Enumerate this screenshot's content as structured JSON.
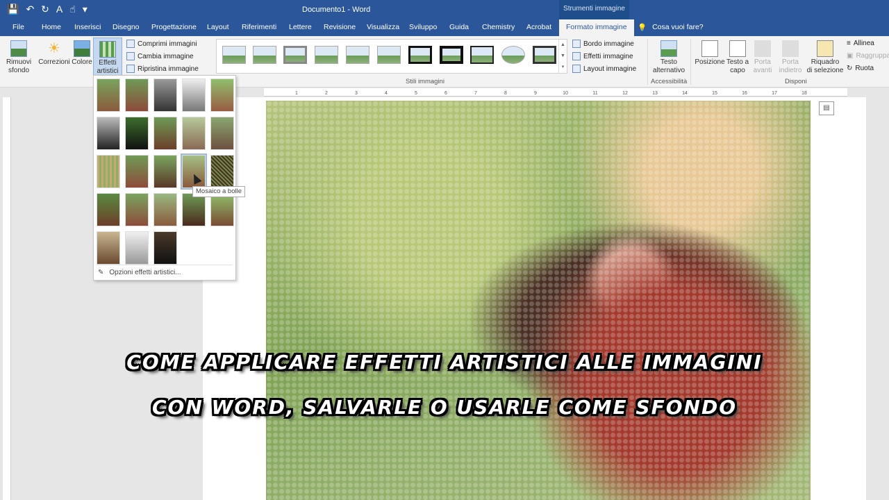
{
  "titlebar": {
    "title": "Documento1  -  Word",
    "context_group": "Strumenti immagine",
    "qat_icons": [
      "save-icon",
      "undo-icon",
      "redo-icon",
      "font-size-icon",
      "touch-mode-icon",
      "customize-qat-icon"
    ]
  },
  "tabs": {
    "file": "File",
    "home": "Home",
    "insert": "Inserisci",
    "draw": "Disegno",
    "design": "Progettazione",
    "layout": "Layout",
    "references": "Riferimenti",
    "mailings": "Lettere",
    "review": "Revisione",
    "view": "Visualizza",
    "developer": "Sviluppo",
    "help": "Guida",
    "chemistry": "Chemistry",
    "acrobat": "Acrobat",
    "format_picture": "Formato immagine",
    "tell_me": "Cosa vuoi fare?"
  },
  "ribbon": {
    "remove_bg_1": "Rimuovi",
    "remove_bg_2": "sfondo",
    "corrections": "Correzioni",
    "color": "Colore",
    "artistic_effects_1": "Effetti",
    "artistic_effects_2": "artistici",
    "compress": "Comprimi immagini",
    "change_picture": "Cambia immagine",
    "reset_picture": "Ripristina immagine",
    "styles_group": "Stili immagini",
    "border": "Bordo immagine",
    "effects": "Effetti immagine",
    "picture_layout": "Layout immagine",
    "alt_text_1": "Testo",
    "alt_text_2": "alternativo",
    "accessibility_group": "Accessibilità",
    "position": "Posizione",
    "wrap_text_1": "Testo a",
    "wrap_text_2": "capo",
    "bring_forward_1": "Porta",
    "bring_forward_2": "avanti",
    "send_backward_1": "Porta",
    "send_backward_2": "indietro",
    "selection_pane_1": "Riquadro",
    "selection_pane_2": "di selezione",
    "align": "Allinea",
    "group": "Raggruppa",
    "rotate": "Ruota",
    "arrange_group": "Disponi"
  },
  "ruler": {
    "labels": [
      "1",
      "2",
      "3",
      "4",
      "5",
      "6",
      "7",
      "8",
      "9",
      "10",
      "11",
      "12",
      "13",
      "14",
      "15",
      "16",
      "17",
      "18"
    ]
  },
  "dropdown": {
    "tooltip": "Mosaico a bolle",
    "options_label": "Opzioni effetti artistici..."
  },
  "caption": {
    "line1": "COME APPLICARE EFFETTI ARTISTICI ALLE IMMAGINI",
    "line2": "CON WORD, SALVARLE O USARLE COME SFONDO"
  },
  "colors": {
    "title_bar": "#2b579a",
    "context_tab": "#1e4e8c",
    "ribbon_bg": "#f3f3f3",
    "selection_outline": "#9fb9da"
  }
}
